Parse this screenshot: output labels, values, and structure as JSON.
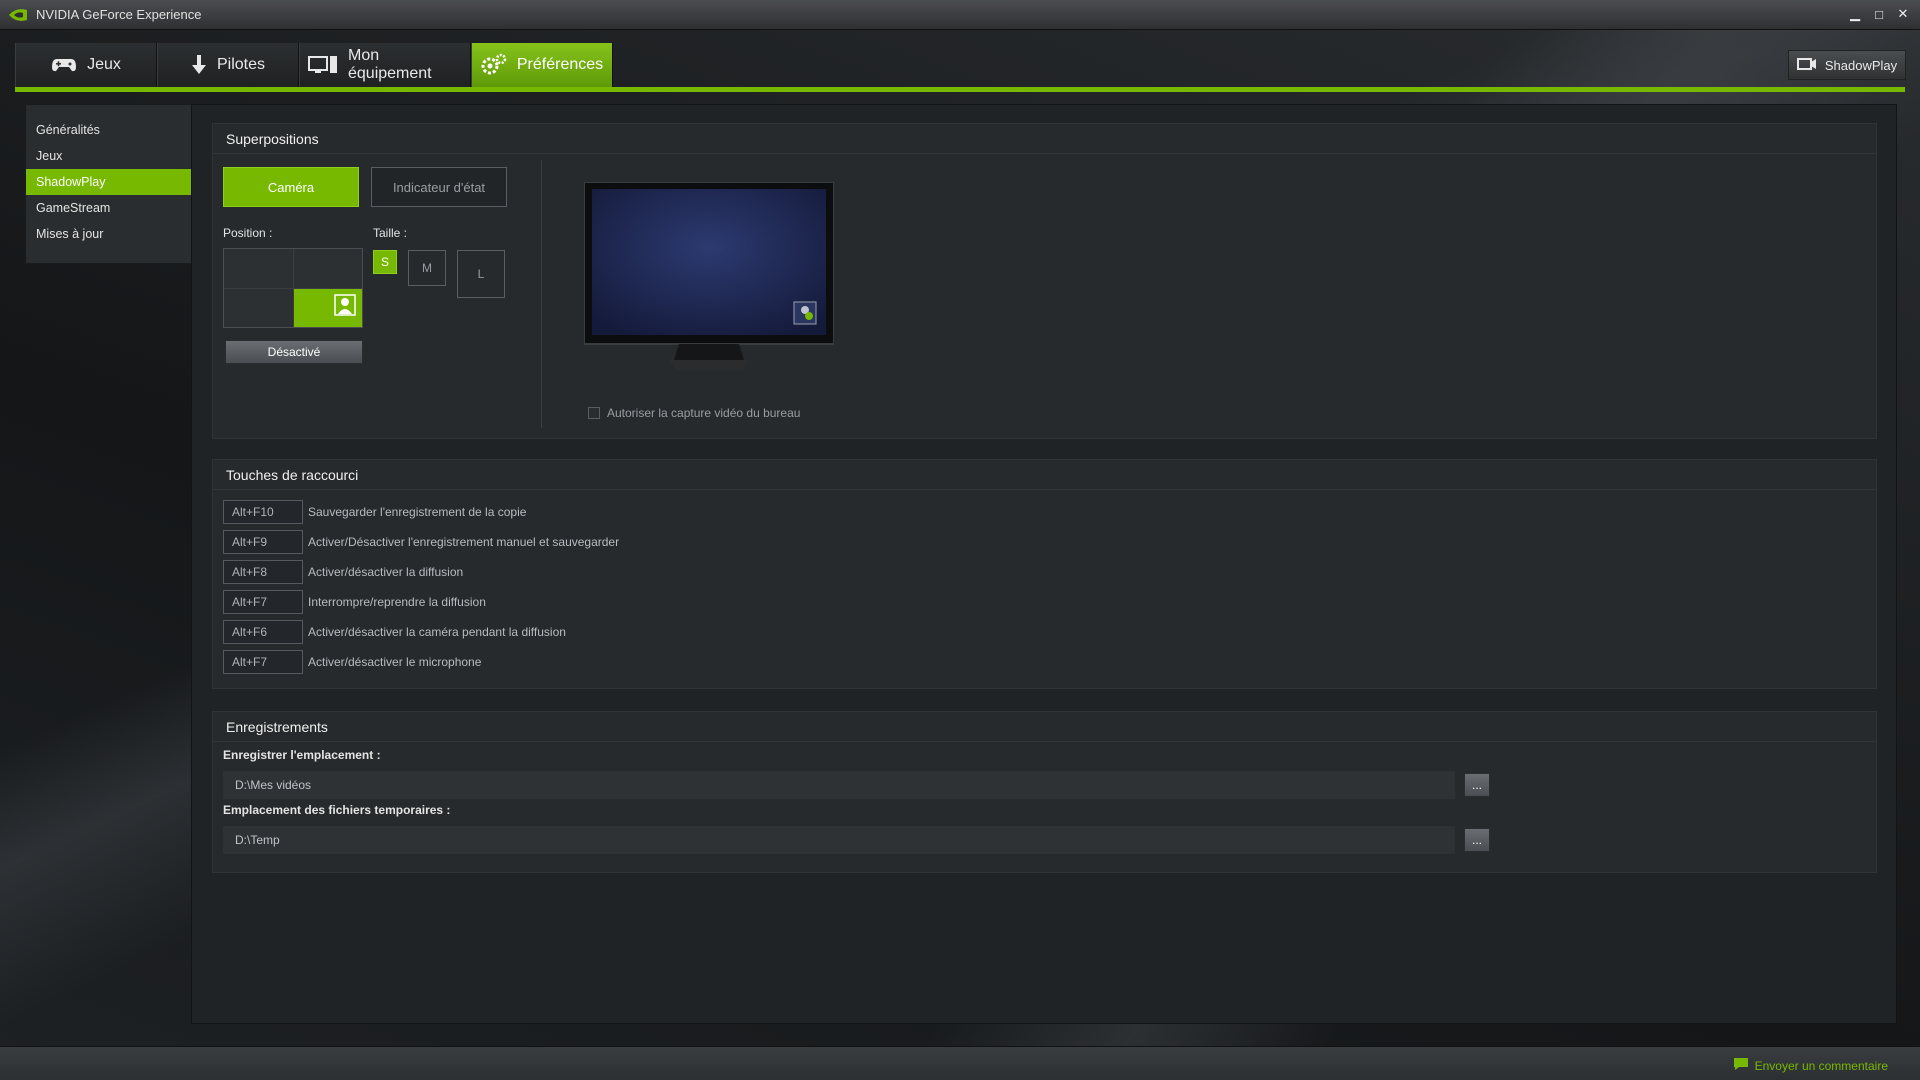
{
  "window": {
    "title": "NVIDIA GeForce Experience"
  },
  "tabs": [
    {
      "label": "Jeux",
      "icon": "gamepad-icon"
    },
    {
      "label": "Pilotes",
      "icon": "driver-download-icon"
    },
    {
      "label": "Mon équipement",
      "icon": "monitor-icon"
    },
    {
      "label": "Préférences",
      "icon": "gears-icon",
      "active": true
    }
  ],
  "shadowplay_button": "ShadowPlay",
  "sidebar": {
    "items": [
      {
        "label": "Généralités"
      },
      {
        "label": "Jeux"
      },
      {
        "label": "ShadowPlay",
        "active": true
      },
      {
        "label": "GameStream"
      },
      {
        "label": "Mises à jour"
      }
    ]
  },
  "overlays": {
    "title": "Superpositions",
    "camera_tab": "Caméra",
    "status_tab": "Indicateur d'état",
    "position_label": "Position :",
    "size_label": "Taille :",
    "sizes": [
      "S",
      "M",
      "L"
    ],
    "selected_size": "S",
    "toggle_button": "Désactivé",
    "desktop_capture_label": "Autoriser la capture vidéo du bureau"
  },
  "hotkeys": {
    "title": "Touches de raccourci",
    "rows": [
      {
        "key": "Alt+F10",
        "desc": "Sauvegarder l'enregistrement de la copie"
      },
      {
        "key": "Alt+F9",
        "desc": "Activer/Désactiver l'enregistrement manuel et sauvegarder"
      },
      {
        "key": "Alt+F8",
        "desc": "Activer/désactiver la diffusion"
      },
      {
        "key": "Alt+F7",
        "desc": "Interrompre/reprendre la diffusion"
      },
      {
        "key": "Alt+F6",
        "desc": "Activer/désactiver la caméra pendant la diffusion"
      },
      {
        "key": "Alt+F7",
        "desc": "Activer/désactiver le microphone"
      }
    ]
  },
  "recordings": {
    "title": "Enregistrements",
    "save_location_label": "Enregistrer l'emplacement :",
    "save_location_value": "D:\\Mes vidéos",
    "temp_location_label": "Emplacement des fichiers temporaires :",
    "temp_location_value": "D:\\Temp",
    "browse_label": "..."
  },
  "footer": {
    "feedback": "Envoyer un commentaire"
  },
  "colors": {
    "accent": "#76b900"
  }
}
